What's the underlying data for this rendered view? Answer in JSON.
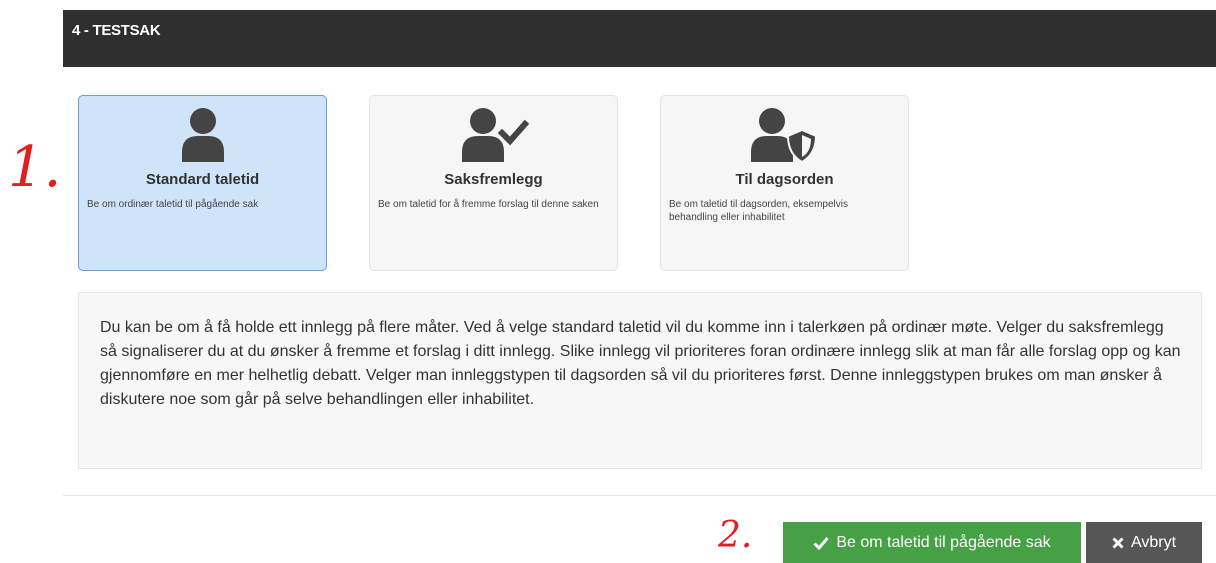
{
  "header": {
    "title": "4 - TESTSAK"
  },
  "annotations": {
    "first": "1.",
    "second": "2."
  },
  "options": [
    {
      "title": "Standard taletid",
      "description": "Be om ordinær taletid til pågående sak",
      "icon": "person-icon",
      "selected": true
    },
    {
      "title": "Saksfremlegg",
      "description": "Be om taletid for å fremme forslag til denne saken",
      "icon": "person-check-icon",
      "selected": false
    },
    {
      "title": "Til dagsorden",
      "description": "Be om taletid til dagsorden, eksempelvis behandling eller inhabilitet",
      "icon": "person-shield-icon",
      "selected": false
    }
  ],
  "info": {
    "text": "Du kan be om å få holde ett innlegg på flere måter. Ved å velge standard taletid vil du komme inn i talerkøen på ordinær møte. Velger du saksfremlegg så signaliserer du at du ønsker å fremme et forslag i ditt innlegg. Slike innlegg vil prioriteres foran ordinære innlegg slik at man får alle forslag opp og kan gjennomføre en mer helhetlig debatt. Velger man innleggstypen til dagsorden så vil du prioriteres først. Denne innleggstypen brukes om man ønsker å diskutere noe som går på selve behandlingen eller inhabilitet."
  },
  "actions": {
    "submit_label": "Be om taletid til pågående sak",
    "submit_icon": "check-icon",
    "cancel_label": "Avbryt",
    "cancel_icon": "close-icon"
  },
  "colors": {
    "header_bg": "#2f2f2f",
    "selected_card_bg": "#cfe4f9",
    "submit_bg": "#46a045",
    "cancel_bg": "#565656",
    "annotation": "#e02020"
  }
}
